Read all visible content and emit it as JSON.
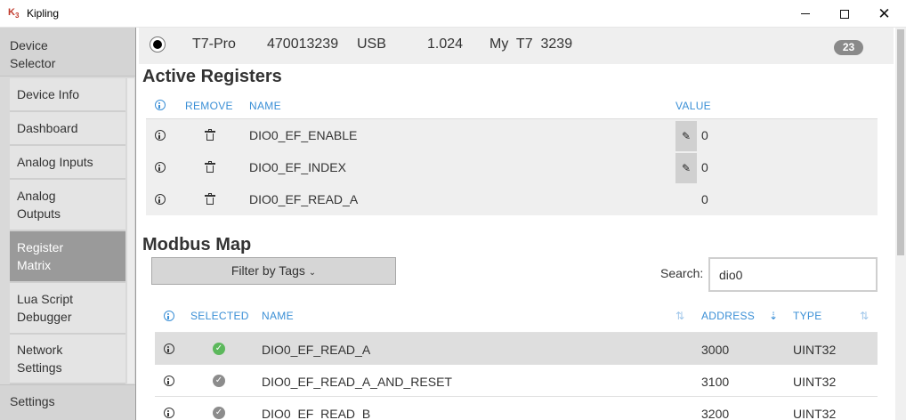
{
  "window": {
    "title": "Kipling",
    "icon_text": "K",
    "icon_sub": "3"
  },
  "sidebar": {
    "header": [
      "Device",
      "Selector"
    ],
    "items": [
      {
        "lines": [
          "Device Info"
        ]
      },
      {
        "lines": [
          "Dashboard"
        ]
      },
      {
        "lines": [
          "Analog Inputs"
        ]
      },
      {
        "lines": [
          "Analog",
          "Outputs"
        ]
      },
      {
        "lines": [
          "Register",
          "Matrix"
        ]
      },
      {
        "lines": [
          "Lua Script",
          "Debugger"
        ]
      },
      {
        "lines": [
          "Network",
          "Settings"
        ]
      }
    ],
    "footer": "Settings"
  },
  "device": {
    "model": "T7-Pro",
    "serial": "470013239",
    "connection": "USB",
    "firmware": "1.024",
    "name": "My  T7  3239",
    "badge": "23"
  },
  "active_registers": {
    "title": "Active Registers",
    "columns": {
      "remove": "REMOVE",
      "name": "NAME",
      "value": "VALUE"
    },
    "rows": [
      {
        "name": "DIO0_EF_ENABLE",
        "value": "0"
      },
      {
        "name": "DIO0_EF_INDEX",
        "value": "0"
      },
      {
        "name": "DIO0_EF_READ_A",
        "value": "0"
      }
    ]
  },
  "modbus_map": {
    "title": "Modbus Map",
    "filter_label": "Filter by Tags",
    "search_label": "Search:",
    "search_value": "dio0",
    "columns": {
      "selected": "SELECTED",
      "name": "NAME",
      "address": "ADDRESS",
      "type": "TYPE"
    },
    "rows": [
      {
        "name": "DIO0_EF_READ_A",
        "address": "3000",
        "type": "UINT32"
      },
      {
        "name": "DIO0_EF_READ_A_AND_RESET",
        "address": "3100",
        "type": "UINT32"
      },
      {
        "name": "DIO0_EF_READ_B",
        "address": "3200",
        "type": "UINT32"
      }
    ]
  },
  "colors": {
    "accent": "#3a8fd6",
    "selected_check": "#5cb85c",
    "active_sidebar": "#9a9a9a"
  }
}
